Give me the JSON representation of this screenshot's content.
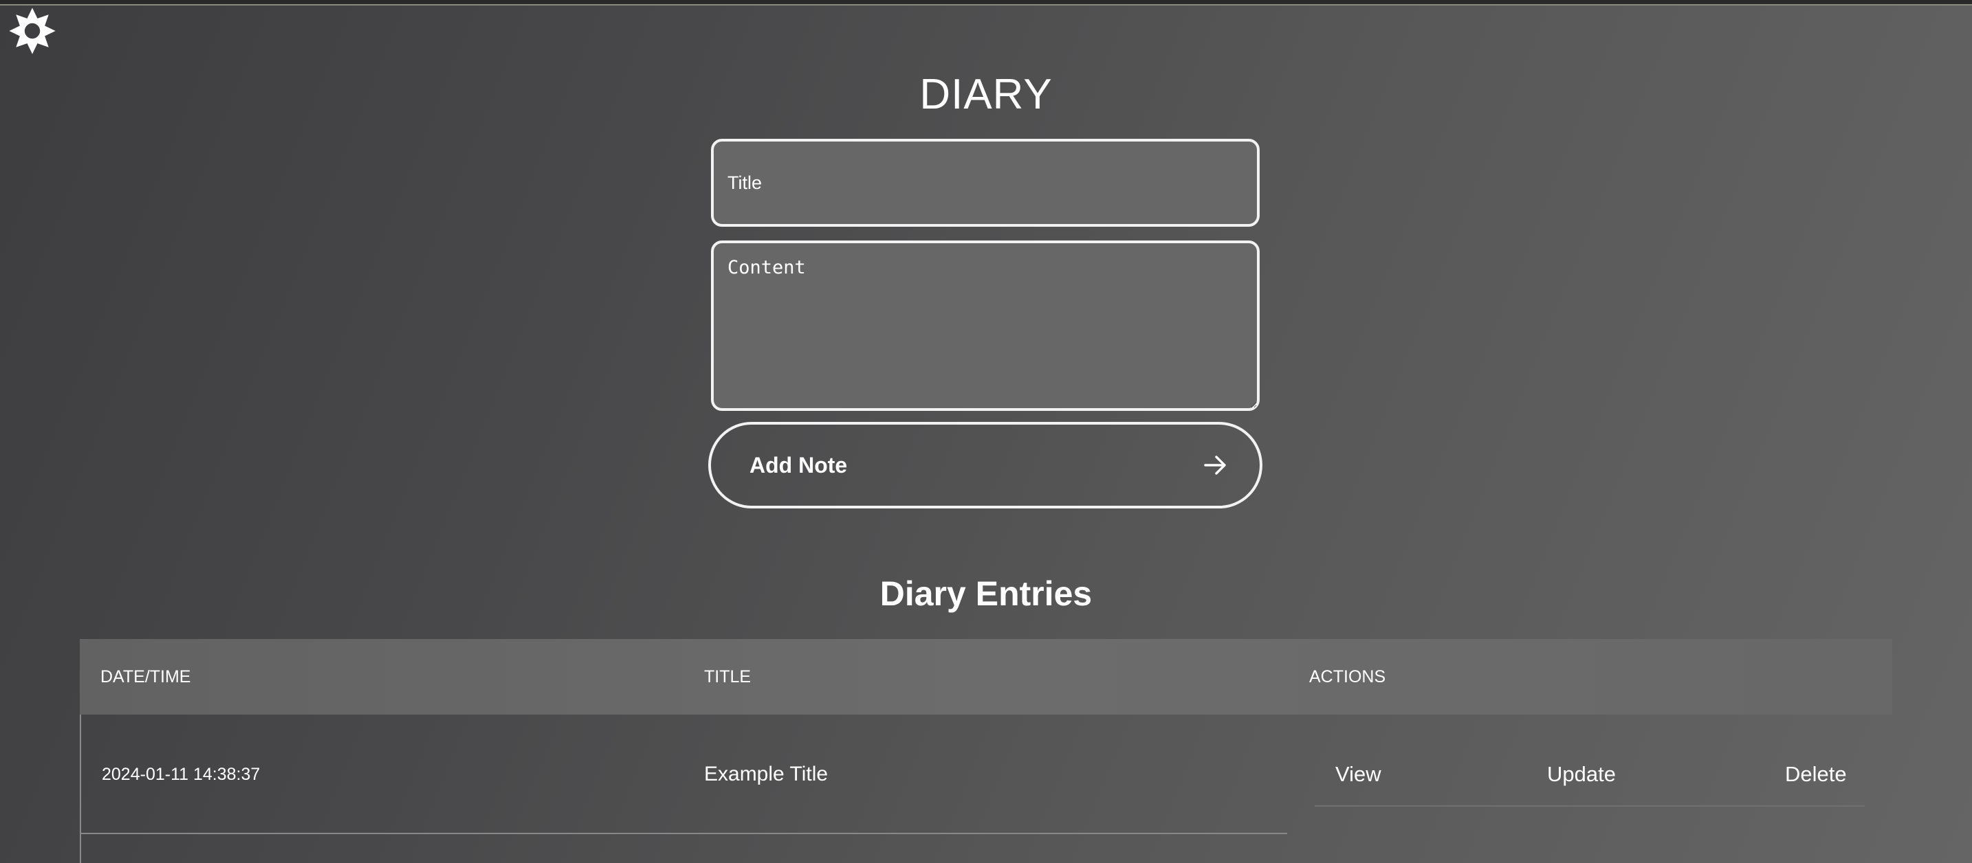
{
  "app": {
    "title": "DIARY"
  },
  "form": {
    "title_placeholder": "Title",
    "title_value": "",
    "content_placeholder": "Content",
    "content_value": "",
    "add_button_label": "Add Note",
    "add_button_icon": "arrow-right-icon"
  },
  "settings": {
    "icon": "gear-icon"
  },
  "entries": {
    "heading": "Diary Entries",
    "columns": [
      "DATE/TIME",
      "TITLE",
      "ACTIONS"
    ],
    "rows": [
      {
        "datetime": "2024-01-11 14:38:37",
        "title": "Example Title",
        "actions": [
          "View",
          "Update",
          "Delete"
        ]
      }
    ]
  },
  "colors": {
    "background_start": "#3d3d40",
    "background_end": "#656565",
    "field_background": "#676767",
    "border": "#f2f2f2",
    "text": "#ffffff"
  }
}
